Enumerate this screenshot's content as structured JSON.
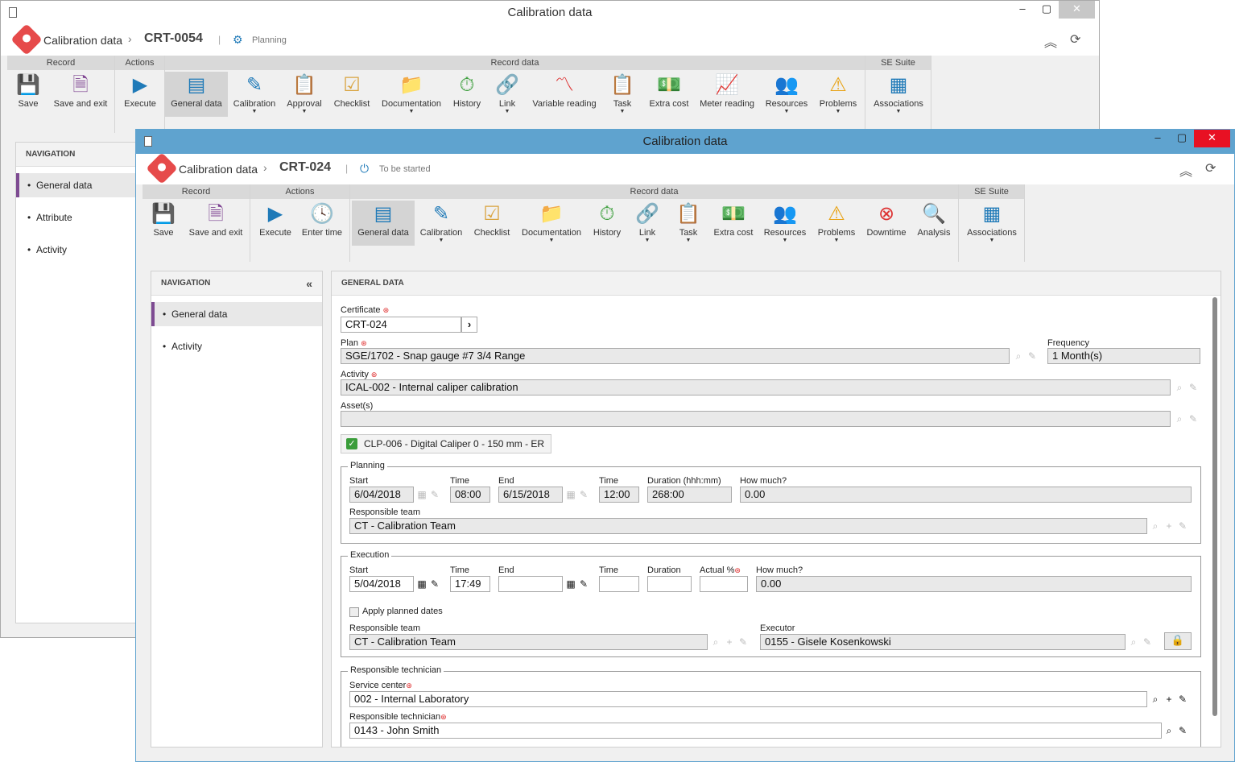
{
  "back": {
    "title": "Calibration data",
    "app": "Calibration data",
    "record": "CRT-0054",
    "status": "Planning",
    "groups": [
      "Record",
      "Actions",
      "Record data",
      "SE Suite"
    ],
    "buttons": [
      "Save",
      "Save and exit",
      "Execute",
      "General data",
      "Calibration",
      "Approval",
      "Checklist",
      "Documentation",
      "History",
      "Link",
      "Variable reading",
      "Task",
      "Extra cost",
      "Meter reading",
      "Resources",
      "Problems",
      "Associations"
    ],
    "nav_header": "NAVIGATION",
    "nav": [
      "General data",
      "Attribute",
      "Activity"
    ]
  },
  "front": {
    "title": "Calibration data",
    "app": "Calibration data",
    "record": "CRT-024",
    "status": "To be started",
    "groups": [
      "Record",
      "Actions",
      "Record data",
      "SE Suite"
    ],
    "buttons": [
      "Save",
      "Save and exit",
      "Execute",
      "Enter time",
      "General data",
      "Calibration",
      "Checklist",
      "Documentation",
      "History",
      "Link",
      "Task",
      "Extra cost",
      "Resources",
      "Problems",
      "Downtime",
      "Analysis",
      "Associations"
    ],
    "nav_header": "NAVIGATION",
    "nav": [
      "General data",
      "Activity"
    ],
    "content_header": "GENERAL DATA",
    "form": {
      "certificate_label": "Certificate",
      "certificate": "CRT-024",
      "plan_label": "Plan",
      "plan": "SGE/1702 - Snap gauge #7 3/4 Range",
      "frequency_label": "Frequency",
      "frequency": "1 Month(s)",
      "activity_label": "Activity",
      "activity": "ICAL-002 - Internal caliper calibration",
      "assets_label": "Asset(s)",
      "asset_chip": "CLP-006 - Digital Caliper 0 - 150 mm - ER",
      "planning": {
        "legend": "Planning",
        "start_label": "Start",
        "start": "6/04/2018",
        "time_label": "Time",
        "time": "08:00",
        "end_label": "End",
        "end": "6/15/2018",
        "time2_label": "Time",
        "time2": "12:00",
        "duration_label": "Duration (hhh:mm)",
        "duration": "268:00",
        "howmuch_label": "How much?",
        "howmuch": "0.00",
        "team_label": "Responsible team",
        "team": "CT - Calibration Team"
      },
      "execution": {
        "legend": "Execution",
        "start_label": "Start",
        "start": "5/04/2018",
        "time_label": "Time",
        "time": "17:49",
        "end_label": "End",
        "end": "",
        "time2_label": "Time",
        "time2": "",
        "duration_label": "Duration",
        "duration": "",
        "actual_label": "Actual %",
        "actual": "",
        "howmuch_label": "How much?",
        "howmuch": "0.00",
        "apply_label": "Apply planned dates",
        "team_label": "Responsible team",
        "team": "CT - Calibration Team",
        "executor_label": "Executor",
        "executor": "0155 - Gisele Kosenkowski"
      },
      "technician": {
        "legend": "Responsible technician",
        "center_label": "Service center",
        "center": "002 - Internal Laboratory",
        "tech_label": "Responsible technician",
        "tech": "0143 - John Smith"
      }
    }
  }
}
